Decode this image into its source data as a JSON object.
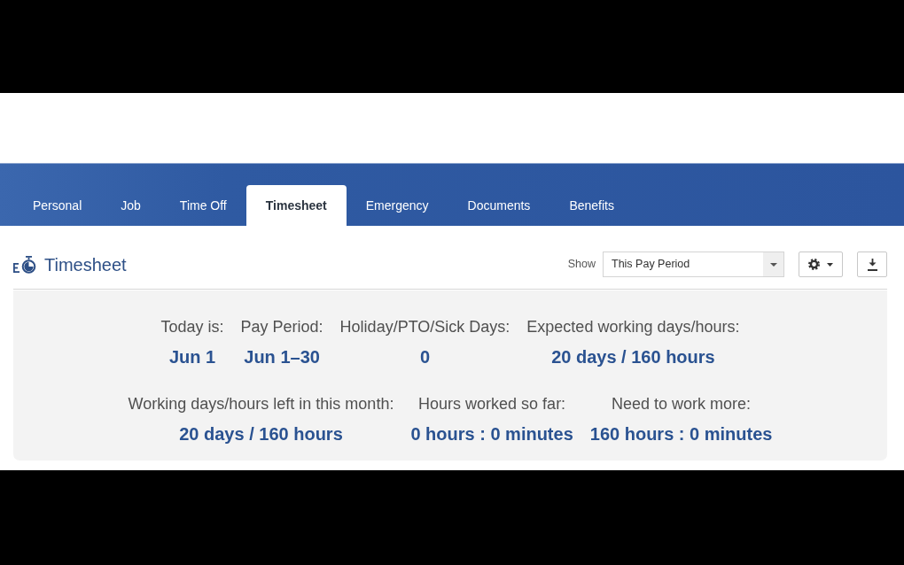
{
  "tabs": [
    {
      "label": "Personal",
      "selected": false
    },
    {
      "label": "Job",
      "selected": false
    },
    {
      "label": "Time Off",
      "selected": false
    },
    {
      "label": "Timesheet",
      "selected": true
    },
    {
      "label": "Emergency",
      "selected": false
    },
    {
      "label": "Documents",
      "selected": false
    },
    {
      "label": "Benefits",
      "selected": false
    }
  ],
  "section": {
    "title": "Timesheet"
  },
  "filter": {
    "label": "Show",
    "value": "This Pay Period"
  },
  "summary": {
    "upper_stats": [
      {
        "label": "Today is:",
        "value": "Jun 1"
      },
      {
        "label": "Pay Period:",
        "value": "Jun 1–30"
      },
      {
        "label": "Holiday/PTO/Sick Days:",
        "value": "0"
      },
      {
        "label": "Expected working days/hours:",
        "value": "20 days / 160 hours"
      }
    ],
    "lower_stats": [
      {
        "label": "Working days/hours left in this month:",
        "value": "20 days / 160 hours"
      },
      {
        "label": "Hours worked so far:",
        "value": "0 hours : 0 minutes"
      },
      {
        "label": "Need to work more:",
        "value": "160 hours : 0 minutes"
      }
    ]
  }
}
